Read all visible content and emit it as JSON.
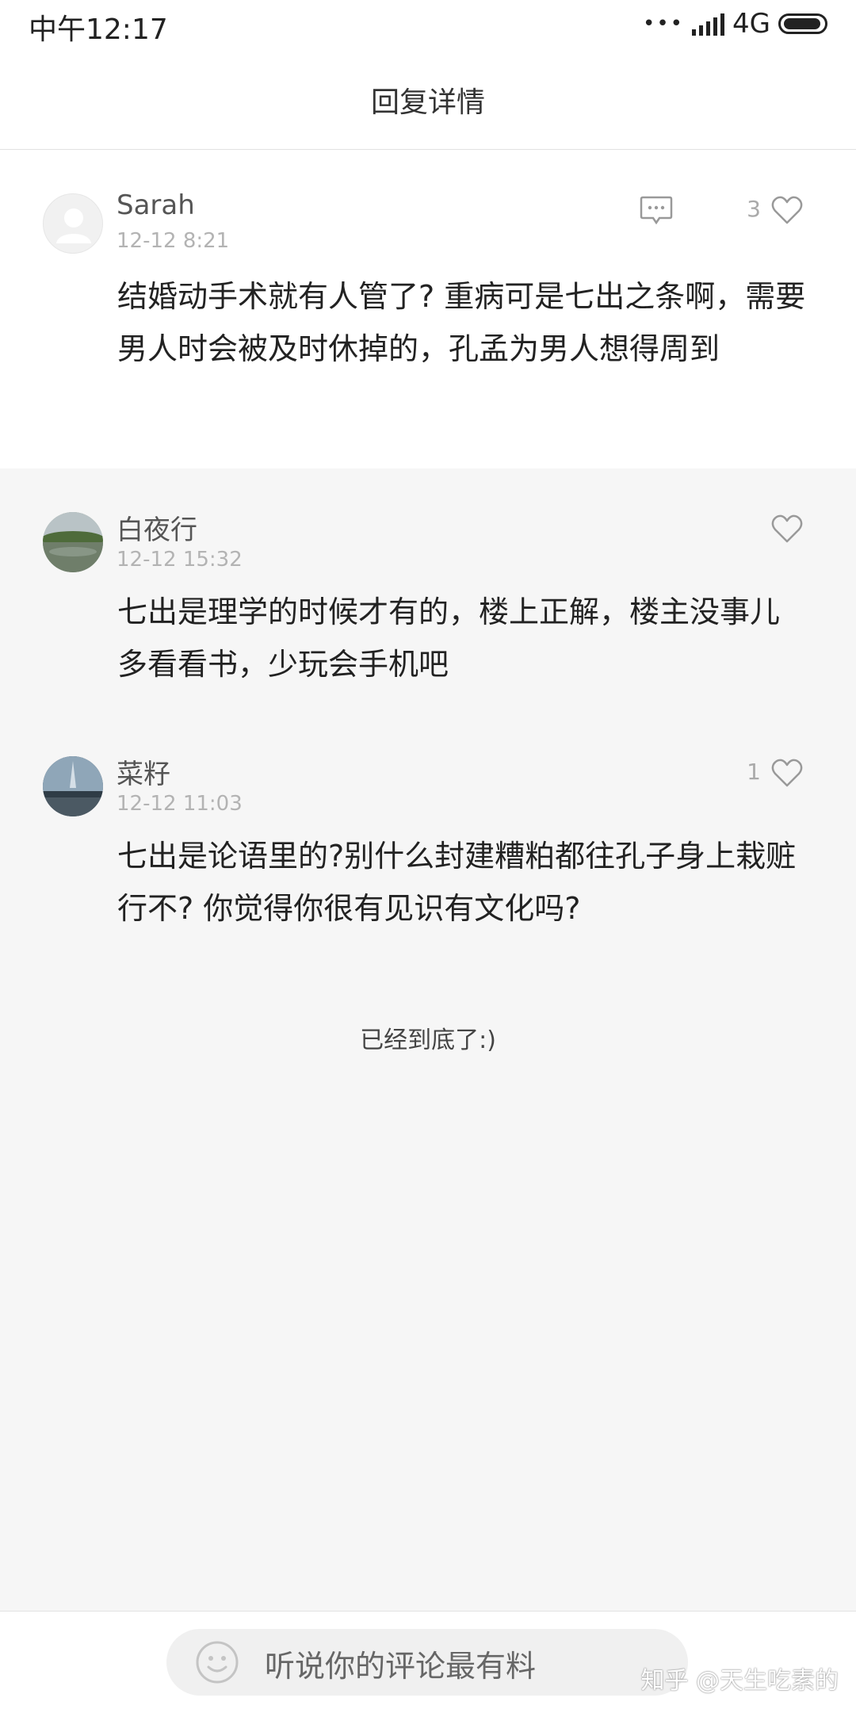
{
  "status": {
    "time": "中午12:17",
    "network": "4G",
    "dots": "•••"
  },
  "header": {
    "title": "回复详情"
  },
  "replies": [
    {
      "name": "Sarah",
      "time": "12-12 8:21",
      "content": "结婚动手术就有人管了? 重病可是七出之条啊，需要男人时会被及时休掉的，孔孟为男人想得周到",
      "likes": "3",
      "avatar": "default-avatar"
    },
    {
      "name": "白夜行",
      "time": "12-12 15:32",
      "content": "七出是理学的时候才有的，楼上正解，楼主没事儿多看看书，少玩会手机吧",
      "likes": "",
      "avatar": "landscape-photo-avatar"
    },
    {
      "name": "菜籽",
      "time": "12-12 11:03",
      "content": "七出是论语里的?别什么封建糟粕都往孔子身上栽赃行不? 你觉得你很有见识有文化吗?",
      "likes": "1",
      "avatar": "sky-photo-avatar"
    }
  ],
  "end_text": "已经到底了:)",
  "input": {
    "placeholder": "听说你的评论最有料"
  },
  "watermark": "知乎 @天生吃素的",
  "colors": {
    "accent_gray": "#b3b3b3",
    "background": "#f6f6f6"
  }
}
